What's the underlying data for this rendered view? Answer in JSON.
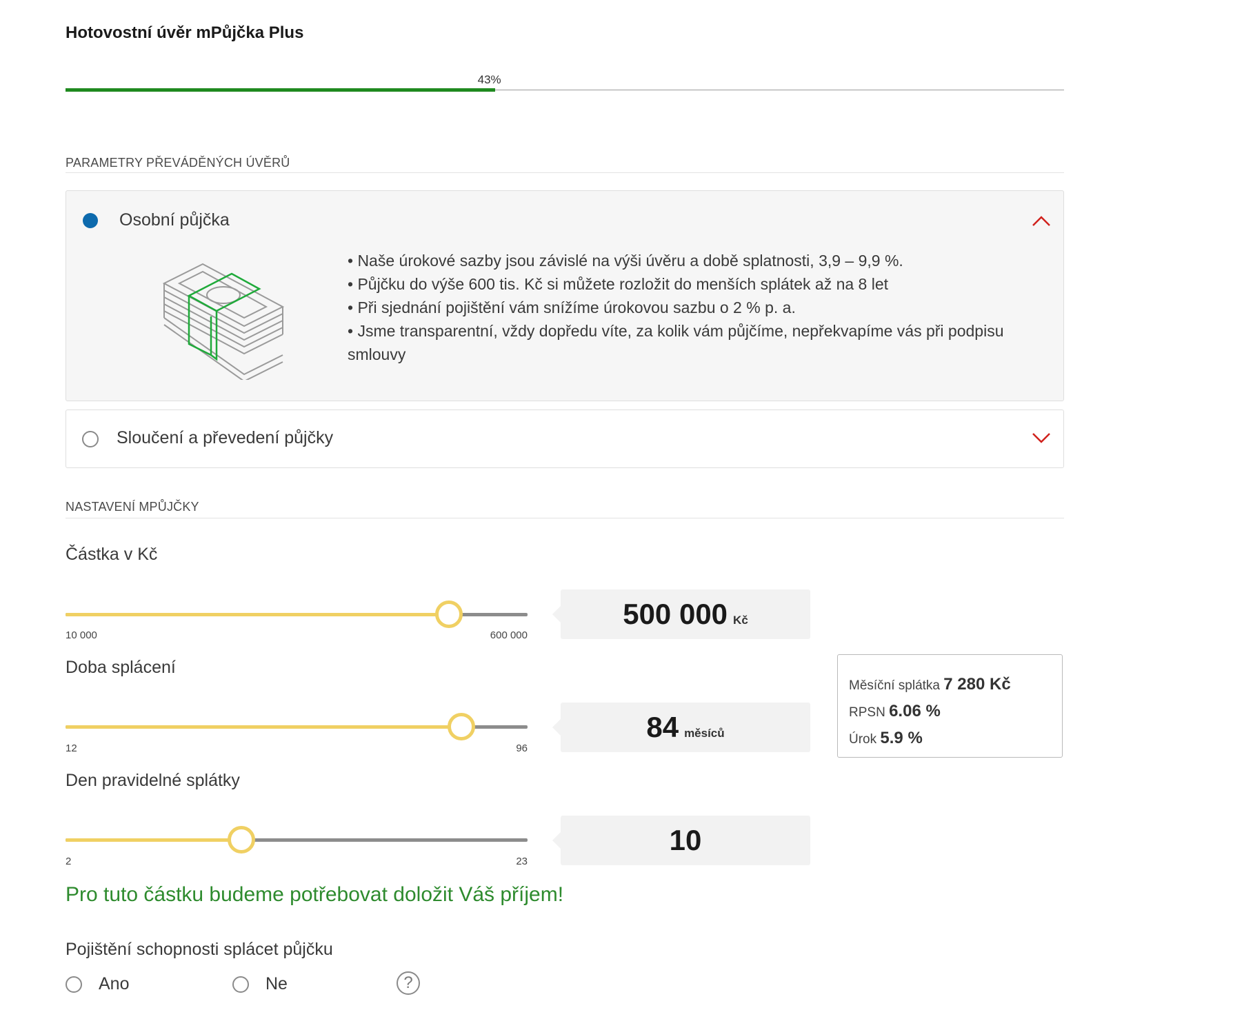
{
  "header": {
    "title": "Hotovostní úvěr mPůjčka Plus",
    "progress_percent": 43,
    "progress_label": "43%"
  },
  "section_loans": {
    "heading": "PARAMETRY PŘEVÁDĚNÝCH ÚVĚRŮ",
    "option_personal": {
      "label": "Osobní půjčka",
      "selected": true,
      "bullets": [
        "• Naše úrokové sazby jsou závislé na výši úvěru a době splatnosti, 3,9 – 9,9 %.",
        "• Půjčku do výše 600 tis. Kč si můžete rozložit do menších splátek až na 8 let",
        "• Při sjednání pojištění vám snížíme úrokovou sazbu o 2 % p. a.",
        "• Jsme transparentní, vždy dopředu víte, za kolik vám půjčíme, nepřekvapíme vás při podpisu smlouvy"
      ]
    },
    "option_merge": {
      "label": "Sloučení a převedení půjčky",
      "selected": false
    }
  },
  "section_settings": {
    "heading": "NASTAVENÍ MPŮJČKY",
    "amount": {
      "label": "Částka v Kč",
      "min_label": "10 000",
      "max_label": "600 000",
      "min": 10000,
      "max": 600000,
      "value": 500000,
      "value_text": "500 000",
      "unit": "Kč"
    },
    "term": {
      "label": "Doba splácení",
      "min_label": "12",
      "max_label": "96",
      "min": 12,
      "max": 96,
      "value": 84,
      "value_text": "84",
      "unit": "měsíců"
    },
    "payment_day": {
      "label": "Den pravidelné splátky",
      "min_label": "2",
      "max_label": "23",
      "min": 2,
      "max": 23,
      "value": 10,
      "value_text": "10",
      "unit": ""
    }
  },
  "summary": {
    "monthly_label": "Měsíční splátka",
    "monthly_value": "7 280 Kč",
    "rpsn_label": "RPSN",
    "rpsn_value": "6.06 %",
    "rate_label": "Úrok",
    "rate_value": "5.9 %"
  },
  "warning": "Pro tuto částku budeme potřebovat doložit Váš příjem!",
  "insurance": {
    "label": "Pojištění schopnosti splácet půjčku",
    "yes_label": "Ano",
    "no_label": "Ne",
    "help_symbol": "?"
  },
  "colors": {
    "progress": "#1f8a1f",
    "slider": "#f0d063",
    "radio_selected": "#0d6aad",
    "chevron": "#d0211c",
    "warning": "#2e8b2e",
    "illustration_accent": "#1faa3a"
  }
}
